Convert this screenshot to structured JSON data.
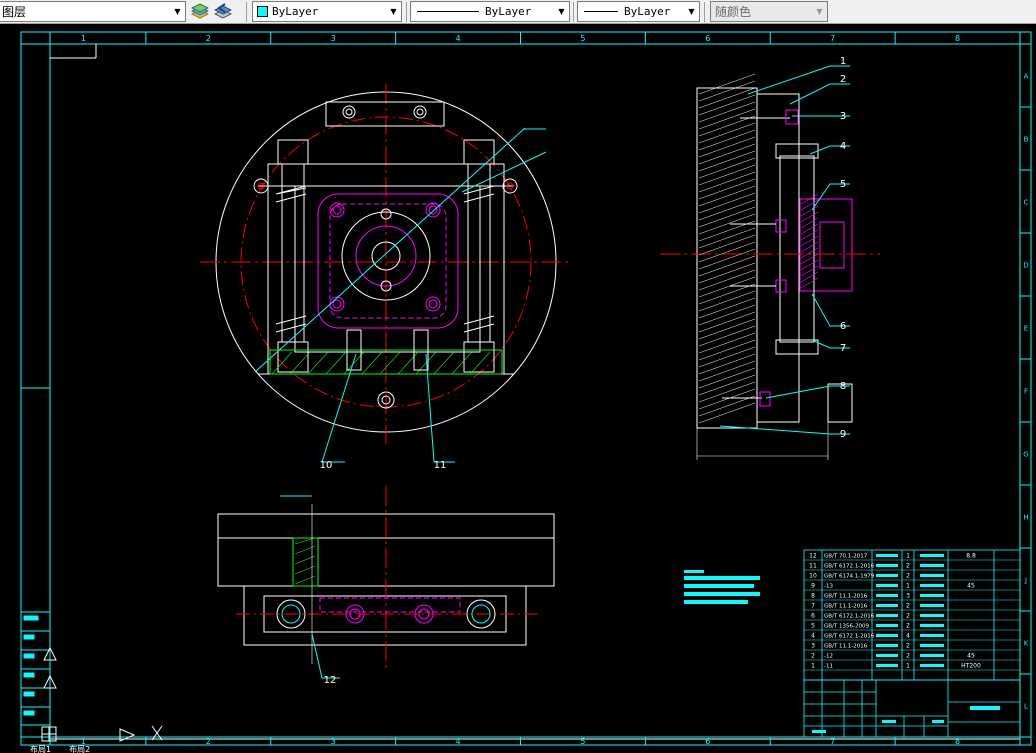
{
  "toolbar": {
    "layer_label": "图层",
    "linetype_label": "ByLayer",
    "lineweight_label": "ByLayer",
    "plotstyle_label": "ByLayer",
    "color_label": "随颜色"
  },
  "frame": {
    "columns": [
      "1",
      "2",
      "3",
      "4",
      "5",
      "6",
      "7",
      "8"
    ],
    "rows": [
      "A",
      "B",
      "C",
      "D",
      "E",
      "F",
      "G",
      "H",
      "J",
      "K",
      "L"
    ]
  },
  "callouts": [
    "1",
    "2",
    "3",
    "4",
    "5",
    "6",
    "7",
    "8",
    "9",
    "10",
    "11",
    "12"
  ],
  "bom_rows": [
    {
      "no": "12",
      "code": "GB/T 70.1-2017",
      "qty": "1",
      "note": "8.8"
    },
    {
      "no": "11",
      "code": "GB/T 6172.1-2016",
      "qty": "2",
      "note": ""
    },
    {
      "no": "10",
      "code": "GB/T 6174.1-1979",
      "qty": "2",
      "note": ""
    },
    {
      "no": "9",
      "code": "-13",
      "qty": "1",
      "note": "45"
    },
    {
      "no": "8",
      "code": "GB/T 11.1-2016",
      "qty": "3",
      "note": ""
    },
    {
      "no": "7",
      "code": "GB/T 11.1-2016",
      "qty": "2",
      "note": ""
    },
    {
      "no": "6",
      "code": "GB/T 6172.1-2016",
      "qty": "2",
      "note": ""
    },
    {
      "no": "5",
      "code": "GB/T 1356-2009",
      "qty": "2",
      "note": ""
    },
    {
      "no": "4",
      "code": "GB/T 6172.1-2016",
      "qty": "4",
      "note": ""
    },
    {
      "no": "3",
      "code": "GB/T 11.1-2016",
      "qty": "2",
      "note": ""
    },
    {
      "no": "2",
      "code": "-12",
      "qty": "2",
      "note": "45"
    },
    {
      "no": "1",
      "code": "-11",
      "qty": "1",
      "note": "HT200"
    }
  ],
  "statusbar": {
    "tabs": [
      "布局1",
      "布局2"
    ]
  },
  "colors": {
    "background": "#000000",
    "frame": "#00ffff",
    "outline": "#ffffff",
    "centerline": "#ff0000",
    "section": "#ff00ff"
  }
}
